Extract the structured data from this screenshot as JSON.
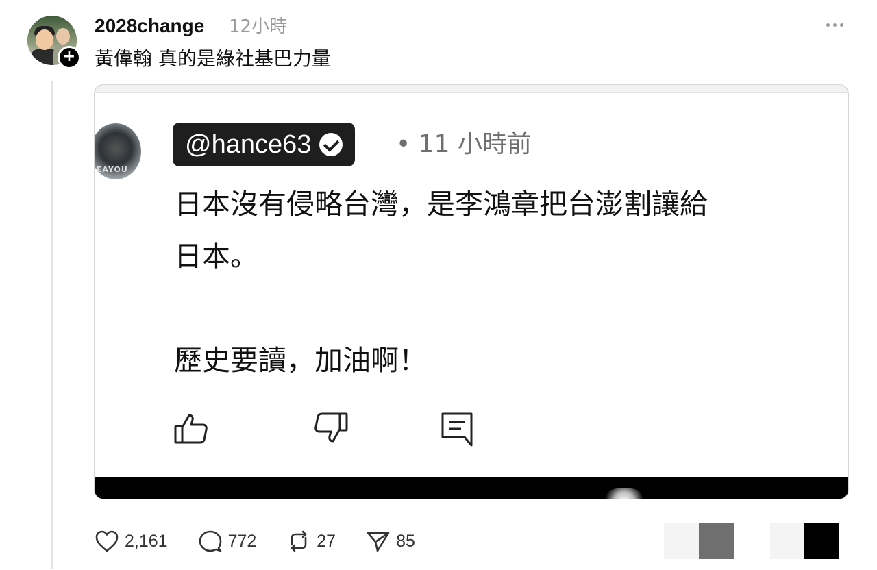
{
  "post": {
    "username": "2028change",
    "time_ago": "12小時",
    "text": "黃偉翰 真的是綠社基巴力量",
    "follow_symbol": "+"
  },
  "embedded_screenshot": {
    "handle": "@hance63",
    "time": "• 11 小時前",
    "comment": "日本沒有侵略台灣，是李鴻章把台澎割讓給\n日本。\n\n歷史要讀，加油啊！",
    "avatar_watermark": "SEAYOU",
    "icons": [
      "thumbs-up-icon",
      "thumbs-down-icon",
      "reply-comment-icon"
    ]
  },
  "actions": {
    "likes": "2,161",
    "comments": "772",
    "reposts": "27",
    "shares": "85"
  },
  "colors": {
    "text": "#111111",
    "muted": "#9a9a9a",
    "thread_line": "#e3e3e3",
    "pill": "#1e1e1e"
  }
}
